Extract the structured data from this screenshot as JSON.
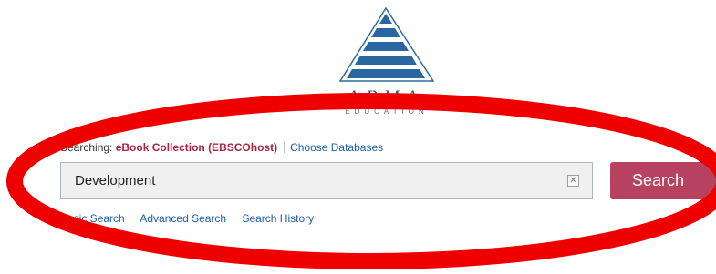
{
  "logo": {
    "text": "ABMA",
    "subtext": "EDUCATION",
    "color": "#1d5a8e"
  },
  "search_context": {
    "prefix": "Searching:",
    "database": "eBook Collection (EBSCOhost)",
    "choose_databases": "Choose Databases"
  },
  "search": {
    "value": "Development",
    "clear_icon": "clear-icon",
    "button_label": "Search",
    "button_color": "#b7425f"
  },
  "links": {
    "basic": "Basic Search",
    "advanced": "Advanced Search",
    "history": "Search History"
  },
  "annotation": {
    "shape": "ellipse",
    "color": "#ee0000"
  }
}
